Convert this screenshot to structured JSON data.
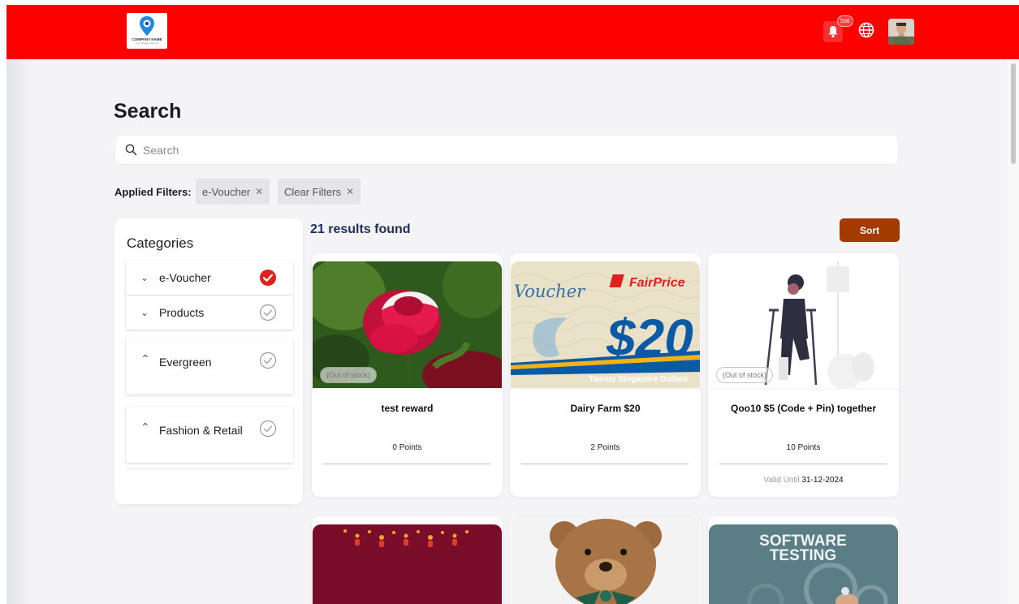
{
  "header": {
    "logo_text": "COMPANY NAME",
    "logo_subtext": "your slogan & tag line",
    "notification_count": "536",
    "icons": [
      "bell-icon",
      "globe-icon",
      "avatar"
    ],
    "brand_color": "#ff0000"
  },
  "page": {
    "title": "Search",
    "search_placeholder": "Search"
  },
  "filters": {
    "label": "Applied Filters:",
    "chips": [
      {
        "label": "e-Voucher"
      },
      {
        "label": "Clear Filters"
      }
    ]
  },
  "categories": {
    "title": "Categories",
    "items": [
      {
        "label": "e-Voucher",
        "expanded": false,
        "checked": true
      },
      {
        "label": "Products",
        "expanded": false,
        "checked": false
      },
      {
        "label": "Evergreen",
        "expanded": true,
        "checked": false
      },
      {
        "label": "Fashion & Retail",
        "expanded": true,
        "checked": false
      }
    ]
  },
  "results": {
    "count_text": "21 results found",
    "sort_label": "Sort",
    "sort_color": "#a33a00",
    "out_of_stock_label": "(Out of stock)",
    "valid_until_label": "Valid Until",
    "cards": [
      {
        "name": "test reward",
        "points": "0 Points",
        "out_of_stock": true,
        "image": "red-rose"
      },
      {
        "name": "Dairy Farm $20",
        "points": "2 Points",
        "out_of_stock": false,
        "image": "fairprice-voucher",
        "voucher_word": "Voucher",
        "voucher_brand": "FairPrice",
        "voucher_amount": "$20",
        "voucher_caption": "Twenty Singapore Dollars"
      },
      {
        "name": "Qoo10 $5 (Code + Pin) together",
        "points": "10 Points",
        "out_of_stock": true,
        "image": "person-on-crutches",
        "valid_until": "31-12-2024"
      },
      {
        "image": "red-festive-banner"
      },
      {
        "image": "teddy-bear"
      },
      {
        "image": "software-testing",
        "image_text_1": "SOFTWARE",
        "image_text_2": "TESTING"
      }
    ]
  }
}
